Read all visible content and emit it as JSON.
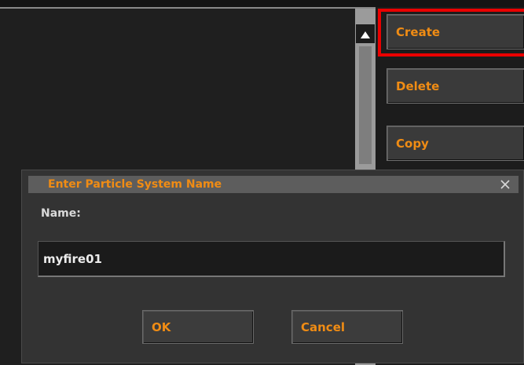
{
  "side_buttons": {
    "create": "Create",
    "delete": "Delete",
    "copy": "Copy"
  },
  "dialog": {
    "title": "Enter Particle System Name",
    "name_label": "Name:",
    "name_value": "myfire01",
    "ok_label": "OK",
    "cancel_label": "Cancel"
  },
  "icons": {
    "scroll_up": "triangle-up-icon",
    "close": "close-icon"
  },
  "colors": {
    "accent_text": "#f08c14",
    "highlight": "#ea0000"
  }
}
